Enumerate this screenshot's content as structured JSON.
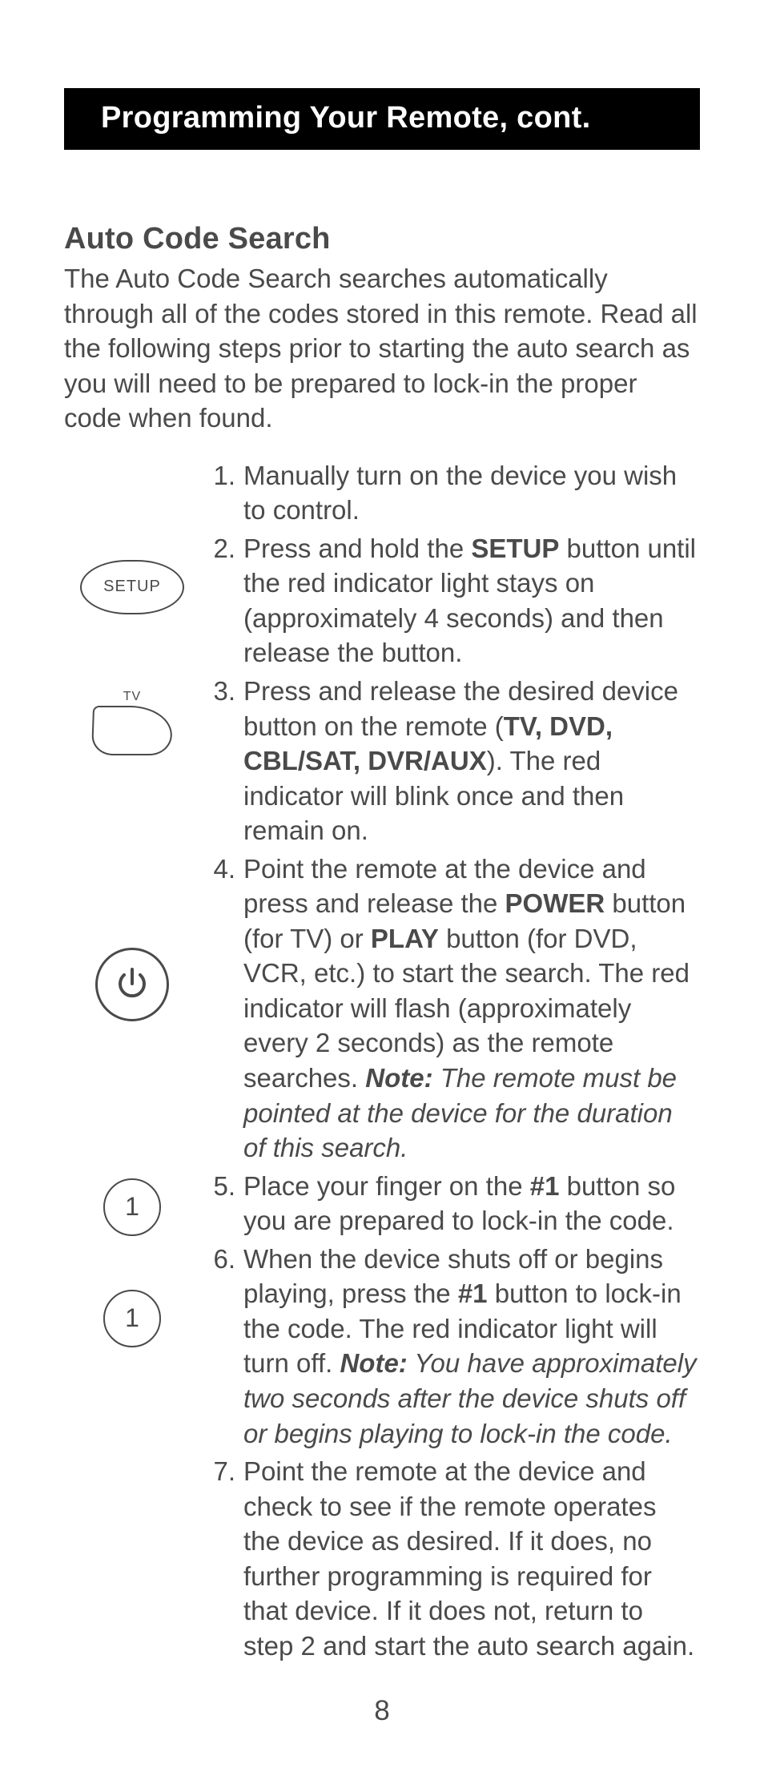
{
  "header": {
    "title": "Programming Your Remote, cont."
  },
  "section": {
    "title": "Auto Code Search",
    "intro": "The Auto Code Search searches automatically through all of the codes stored in this remote. Read all the following steps prior to starting the auto search as you will need to be prepared to lock-in the proper code when found."
  },
  "icons": {
    "setup_label": "SETUP",
    "tv_label": "TV",
    "one_label": "1"
  },
  "steps": {
    "s1": {
      "num": "1.",
      "text": "Manually turn on the device you wish to control."
    },
    "s2": {
      "num": "2.",
      "t1": "Press and hold the ",
      "b1": "SETUP",
      "t2": " button until the red indicator light stays on (approximately 4 seconds) and then release the button."
    },
    "s3": {
      "num": "3.",
      "t1": "Press and release the desired device button on the remote (",
      "b1": "TV, DVD, CBL/SAT, DVR/AUX",
      "t2": "). The red indicator will blink once and then remain on."
    },
    "s4": {
      "num": "4.",
      "t1": "Point the remote at the device and press and release the ",
      "b1": "POWER",
      "t2": " button (for TV) or ",
      "b2": "PLAY",
      "t3": " button (for DVD, VCR, etc.) to start the search. The red indicator will flash (approximately every 2 seconds) as the remote searches. ",
      "nb": "Note:",
      "i1": " The remote must be pointed at the device for the duration of this search."
    },
    "s5": {
      "num": "5.",
      "t1": "Place your finger on the ",
      "b1": "#1",
      "t2": " button so you are prepared to lock-in the code."
    },
    "s6": {
      "num": "6.",
      "t1": "When the device shuts off or begins playing, press the ",
      "b1": "#1",
      "t2": " button to lock-in the code.  The red indicator light will turn off. ",
      "nb": "Note:",
      "i1": "  You have approximately two seconds after the device shuts off or begins playing to lock-in the code."
    },
    "s7": {
      "num": "7.",
      "text": "Point the remote at the device and check to see if the remote operates the device as desired. If it does, no further programming is required for that device. If it does not, return to step 2 and start the auto search again."
    }
  },
  "page_number": "8"
}
